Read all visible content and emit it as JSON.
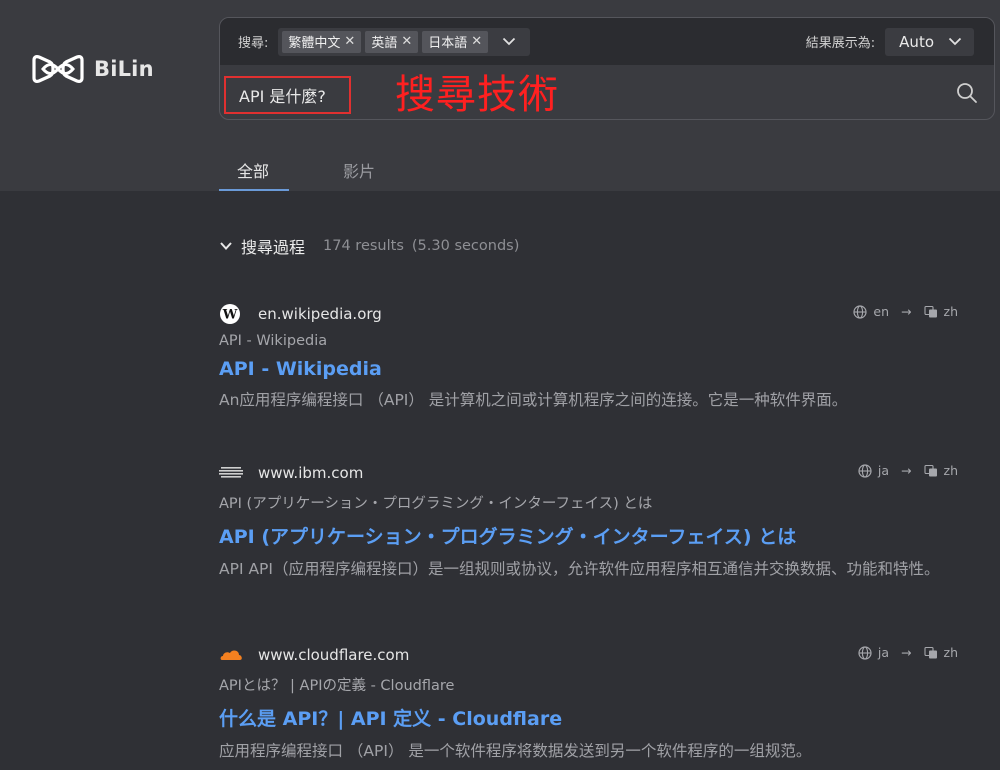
{
  "brand": {
    "name": "BiLin"
  },
  "search": {
    "lang_label": "搜尋:",
    "languages": [
      "繁體中文",
      "英語",
      "日本語"
    ],
    "result_mode_label": "結果展示為:",
    "result_mode_value": "Auto",
    "query": "API 是什麼?"
  },
  "annotation": "搜尋技術",
  "tabs": [
    {
      "label": "全部",
      "active": true
    },
    {
      "label": "影片",
      "active": false
    }
  ],
  "process": {
    "title": "搜尋過程",
    "count": "174 results",
    "time": "(5.30 seconds)"
  },
  "results": [
    {
      "icon": "wikipedia-icon",
      "domain": "en.wikipedia.org",
      "lang_from": "en",
      "lang_to": "zh",
      "crumb": "API - Wikipedia",
      "title": "API - Wikipedia",
      "desc": "An应用程序编程接口 （API） 是计算机之间或计算机程序之间的连接。它是一种软件界面。"
    },
    {
      "icon": "ibm-icon",
      "domain": "www.ibm.com",
      "lang_from": "ja",
      "lang_to": "zh",
      "crumb": "API (アプリケーション・プログラミング・インターフェイス) とは",
      "title": "API (アプリケーション・プログラミング・インターフェイス) とは",
      "desc": "API API（应用程序编程接口）是一组规则或协议，允许软件应用程序相互通信并交换数据、功能和特性。"
    },
    {
      "icon": "cloudflare-icon",
      "domain": "www.cloudflare.com",
      "lang_from": "ja",
      "lang_to": "zh",
      "crumb": "APIとは？ | APIの定義 - Cloudflare",
      "title": "什么是 API？| API 定义 - Cloudflare",
      "desc": "应用程序编程接口 （API） 是一个软件程序将数据发送到另一个软件程序的一组规范。"
    }
  ],
  "colors": {
    "accent_link": "#5b9ef4",
    "annotation_red": "#ff2020",
    "tab_underline": "#6a9ad8"
  }
}
